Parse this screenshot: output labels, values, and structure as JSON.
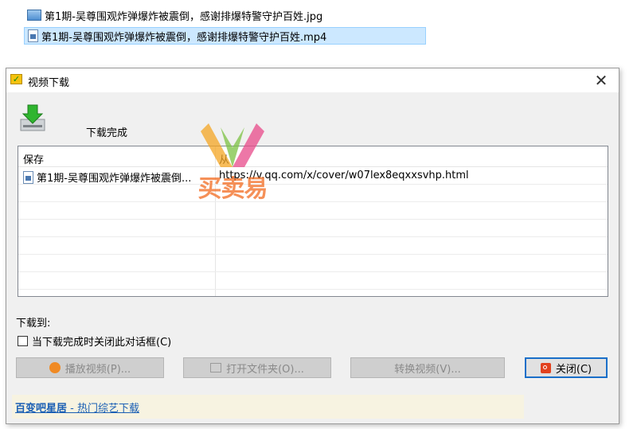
{
  "files": [
    {
      "name": "第1期-吴尊围观炸弹爆炸被震倒，感谢排爆特警守护百姓.jpg",
      "icon": "image-file-icon"
    },
    {
      "name": "第1期-吴尊围观炸弹爆炸被震倒，感谢排爆特警守护百姓.mp4",
      "icon": "video-file-icon"
    }
  ],
  "dialog": {
    "title": "视频下载",
    "close_glyph": "✕",
    "status": "下载完成",
    "list": {
      "col_save": "保存",
      "col_from": "从",
      "rows": [
        {
          "name": "第1期-吴尊围观炸弹爆炸被震倒...",
          "url": "https://v.qq.com/x/cover/w07lex8eqxxsvhp.html"
        }
      ]
    },
    "save_to_label": "下载到:",
    "close_when_done_label": "当下载完成时关闭此对话框(C)",
    "buttons": {
      "play": "播放视频(P)...",
      "open_folder": "打开文件夹(O)...",
      "convert": "转换视频(V)...",
      "close": "关闭(C)"
    },
    "footer": {
      "brand": "百变吧星居",
      "link_suffix": " - 热门综艺下载"
    }
  },
  "watermark": {
    "text": "买卖易"
  },
  "colors": {
    "accent": "#1a6fc9",
    "selection": "#cce8ff",
    "watermark": "#f26b21"
  }
}
